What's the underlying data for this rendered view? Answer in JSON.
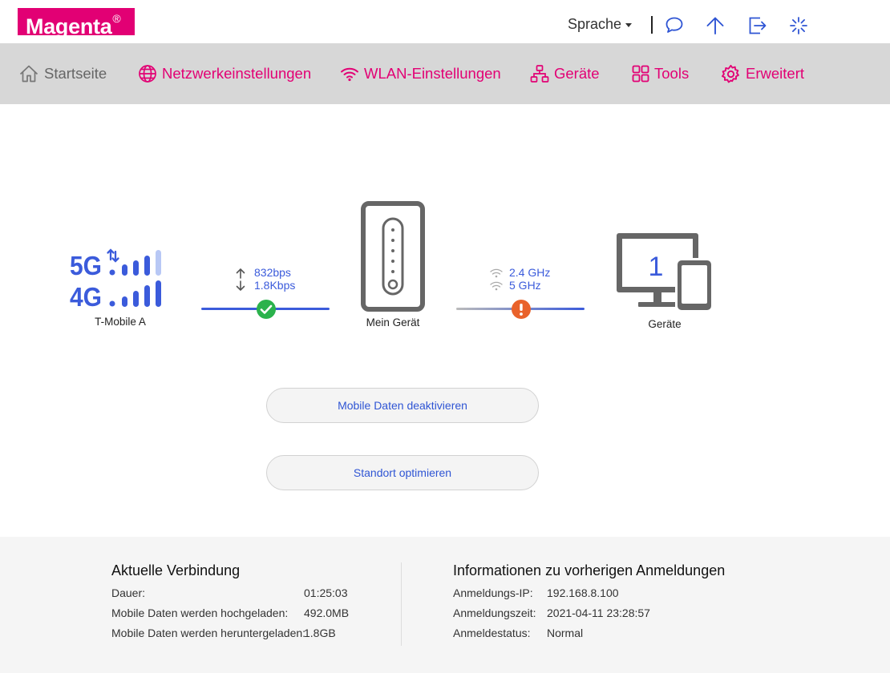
{
  "header": {
    "brand": "Magenta",
    "brand_mark": "®",
    "language_label": "Sprache",
    "icons": [
      "chat-icon",
      "upload-arrow-icon",
      "logout-icon",
      "loading-spinner-icon"
    ]
  },
  "nav": {
    "items": [
      {
        "label": "Startseite",
        "icon": "home-icon"
      },
      {
        "label": "Netzwerkeinstellungen",
        "icon": "globe-icon"
      },
      {
        "label": "WLAN-Einstellungen",
        "icon": "wifi-icon"
      },
      {
        "label": "Geräte",
        "icon": "network-tree-icon"
      },
      {
        "label": "Tools",
        "icon": "grid-icon"
      },
      {
        "label": "Erweitert",
        "icon": "gear-icon"
      }
    ]
  },
  "status": {
    "signal_5g": "5G",
    "signal_4g": "4G",
    "provider": "T-Mobile A",
    "upload_speed": "832bps",
    "download_speed": "1.8Kbps",
    "device_label": "Mein Gerät",
    "wifi_band_1": "2.4 GHz",
    "wifi_band_2": "5 GHz",
    "connected_devices_count": "1",
    "devices_label": "Geräte"
  },
  "actions": {
    "deactivate_mobile_data": "Mobile Daten deaktivieren",
    "optimize_location": "Standort optimieren"
  },
  "current_connection": {
    "title": "Aktuelle Verbindung",
    "rows": [
      {
        "label": "Dauer:",
        "value": "01:25:03"
      },
      {
        "label": "Mobile Daten werden hochgeladen:",
        "value": "492.0MB"
      },
      {
        "label": "Mobile Daten werden heruntergeladen:",
        "value": "1.8GB"
      }
    ]
  },
  "previous_logins": {
    "title": "Informationen zu vorherigen Anmeldungen",
    "rows": [
      {
        "label": "Anmeldungs-IP:",
        "value": "192.168.8.100"
      },
      {
        "label": "Anmeldungszeit:",
        "value": "2021-04-11 23:28:57"
      },
      {
        "label": "Anmeldestatus:",
        "value": "Normal"
      }
    ]
  },
  "colors": {
    "brand": "#e20074",
    "link_blue": "#2f55d4",
    "signal_blue": "#3b5bdb",
    "ok_green": "#2bb24c",
    "warn_orange": "#e9622b"
  }
}
